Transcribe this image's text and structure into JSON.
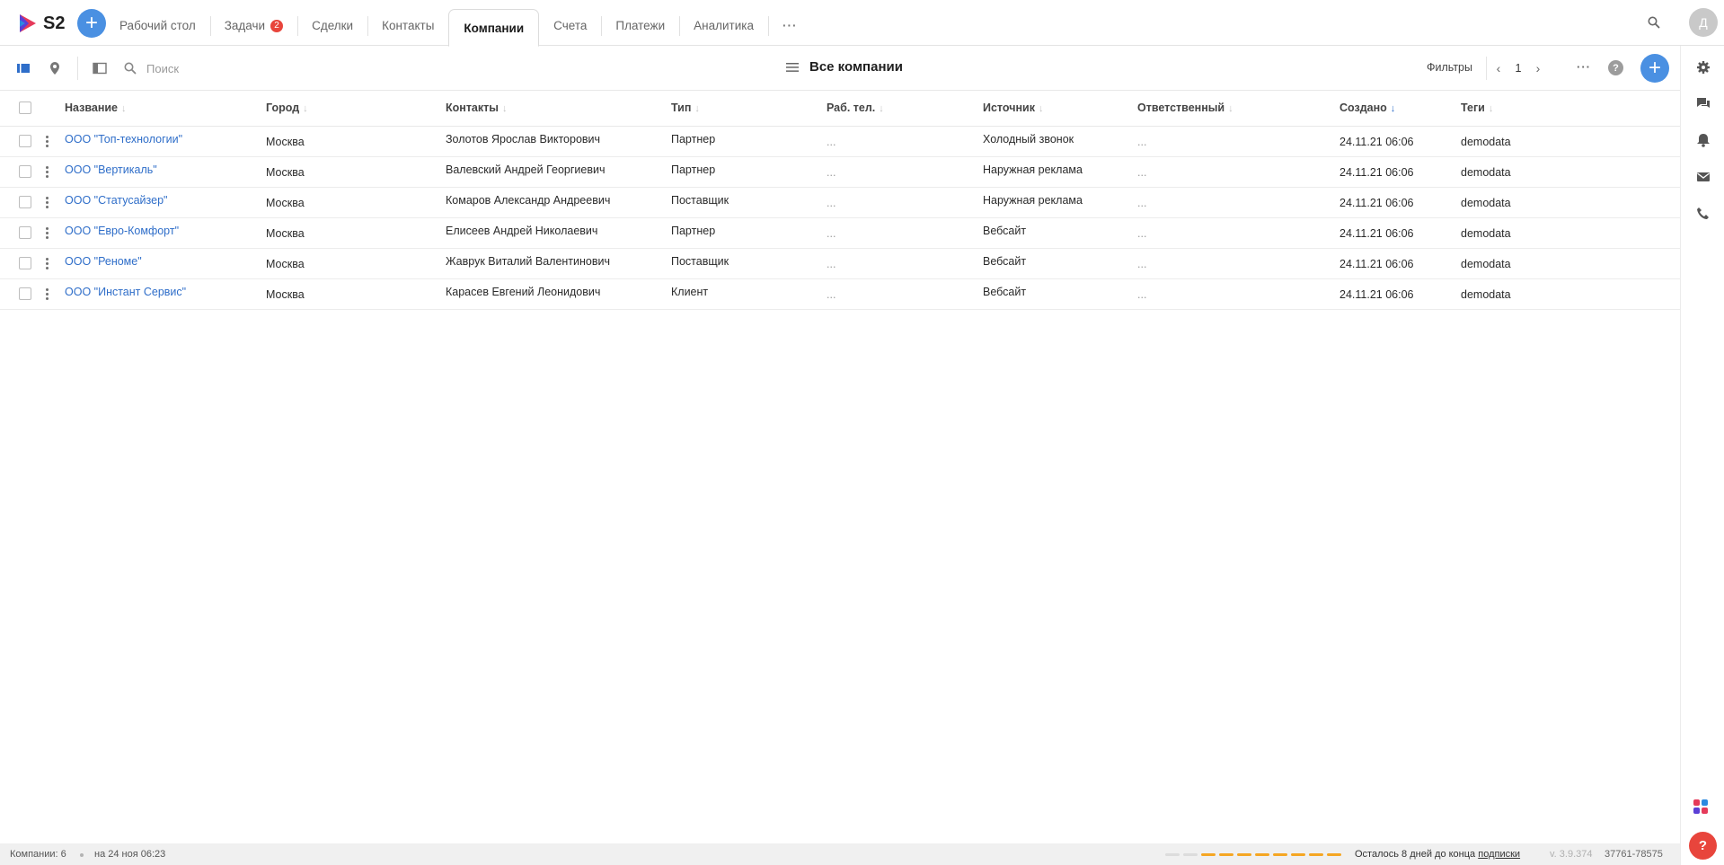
{
  "app": {
    "logo_text": "S2"
  },
  "nav": {
    "tabs": [
      {
        "label": "Рабочий стол",
        "badge": ""
      },
      {
        "label": "Задачи",
        "badge": "2"
      },
      {
        "label": "Сделки",
        "badge": ""
      },
      {
        "label": "Контакты",
        "badge": ""
      },
      {
        "label": "Компании",
        "badge": "",
        "active": true
      },
      {
        "label": "Счета",
        "badge": ""
      },
      {
        "label": "Платежи",
        "badge": ""
      },
      {
        "label": "Аналитика",
        "badge": ""
      }
    ],
    "more": "···",
    "avatar": "Д"
  },
  "toolbar": {
    "search_placeholder": "Поиск",
    "view_title": "Все компании",
    "filters": "Фильтры",
    "page": "1",
    "more": "···",
    "help": "?"
  },
  "table": {
    "columns": [
      "Название",
      "Город",
      "Контакты",
      "Тип",
      "Раб. тел.",
      "Источник",
      "Ответственный",
      "Создано",
      "Теги"
    ],
    "rows": [
      {
        "name": "ООО \"Топ-технологии\"",
        "city": "Москва",
        "contact": "Золотов Ярослав Викторович",
        "type": "Партнер",
        "phone": "...",
        "source": "Холодный звонок",
        "owner": "...",
        "created": "24.11.21 06:06",
        "tags": "demodata"
      },
      {
        "name": "ООО \"Вертикаль\"",
        "city": "Москва",
        "contact": "Валевский Андрей Георгиевич",
        "type": "Партнер",
        "phone": "...",
        "source": "Наружная реклама",
        "owner": "...",
        "created": "24.11.21 06:06",
        "tags": "demodata"
      },
      {
        "name": "ООО \"Статусайзер\"",
        "city": "Москва",
        "contact": "Комаров Александр Андреевич",
        "type": "Поставщик",
        "phone": "...",
        "source": "Наружная реклама",
        "owner": "...",
        "created": "24.11.21 06:06",
        "tags": "demodata"
      },
      {
        "name": "ООО \"Евро-Комфорт\"",
        "city": "Москва",
        "contact": "Елисеев Андрей Николаевич",
        "type": "Партнер",
        "phone": "...",
        "source": "Вебсайт",
        "owner": "...",
        "created": "24.11.21 06:06",
        "tags": "demodata"
      },
      {
        "name": "ООО \"Реноме\"",
        "city": "Москва",
        "contact": "Жаврук Виталий Валентинович",
        "type": "Поставщик",
        "phone": "...",
        "source": "Вебсайт",
        "owner": "...",
        "created": "24.11.21 06:06",
        "tags": "demodata"
      },
      {
        "name": "ООО \"Инстант Сервис\"",
        "city": "Москва",
        "contact": "Карасев Евгений Леонидович",
        "type": "Клиент",
        "phone": "...",
        "source": "Вебсайт",
        "owner": "...",
        "created": "24.11.21 06:06",
        "tags": "demodata"
      }
    ]
  },
  "footer": {
    "count": "Компании: 6",
    "updated": "на 24 ноя 06:23",
    "subscription_text": "Осталось 8 дней до конца",
    "subscription_link": "подписки",
    "subscription_segments_total": 10,
    "subscription_segments_filled": 8,
    "version": "v. 3.9.374",
    "account_id": "37761-78575"
  },
  "colors": {
    "accent": "#4a90e2",
    "link": "#2f6ec9",
    "badge": "#e8453c",
    "progress": "#f5a623"
  }
}
